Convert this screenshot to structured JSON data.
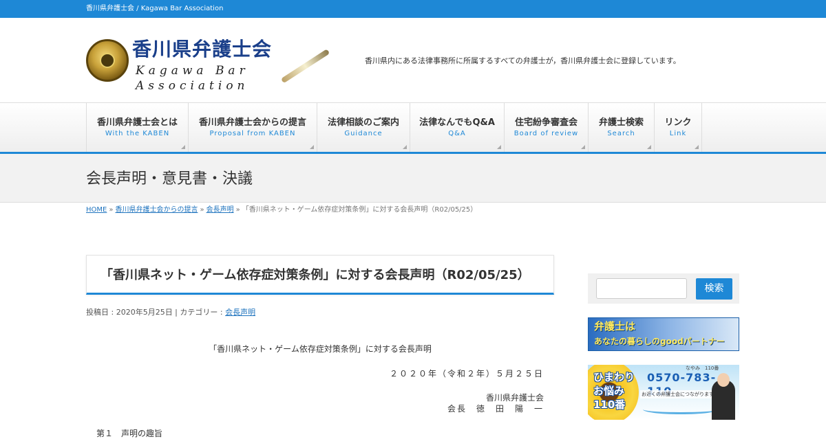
{
  "topbar": {
    "text": "香川県弁護士会 / Kagawa Bar Association"
  },
  "header": {
    "logo_title": "香川県弁護士会",
    "logo_en": "Kagawa Bar Association",
    "description": "香川県内にある法律事務所に所属するすべての弁護士が，香川県弁護士会に登録しています。"
  },
  "nav": {
    "items": [
      {
        "label": "香川県弁護士会とは",
        "sub": "With the KABEN"
      },
      {
        "label": "香川県弁護士会からの提言",
        "sub": "Proposal from KABEN"
      },
      {
        "label": "法律相談のご案内",
        "sub": "Guidance"
      },
      {
        "label": "法律なんでもQ&A",
        "sub": "Q&A"
      },
      {
        "label": "住宅紛争審査会",
        "sub": "Board of review"
      },
      {
        "label": "弁護士検索",
        "sub": "Search"
      },
      {
        "label": "リンク",
        "sub": "Link"
      }
    ]
  },
  "banner": {
    "title": "会長声明・意見書・決議"
  },
  "breadcrumb": {
    "home": "HOME",
    "level1": "香川県弁護士会からの提言",
    "level2": "会長声明",
    "current": "「香川県ネット・ゲーム依存症対策条例」に対する会長声明（R02/05/25）",
    "separator": "»"
  },
  "post": {
    "title": "「香川県ネット・ゲーム依存症対策条例」に対する会長声明（R02/05/25）",
    "meta_prefix": "投稿日 : 2020年5月25日 | カテゴリー : ",
    "category": "会長声明"
  },
  "document": {
    "heading": "「香川県ネット・ゲーム依存症対策条例」に対する会長声明",
    "date": "２０２０年（令和２年）５月２５日",
    "organization": "香川県弁護士会",
    "president": "会長　徳　田　陽　一",
    "section": "第１　声明の趣旨"
  },
  "sidebar": {
    "search_button": "検索",
    "ad1_line1": "弁護士は",
    "ad1_line2": "あなたの暮らしのgoodパートナー",
    "ad2_title_line1": "ひまわり",
    "ad2_title_line2": "お悩み",
    "ad2_title_line3": "110番",
    "ad2_phone": "0570-783-110",
    "ad2_small": "なやみ　110番",
    "ad2_sub": "お近くの弁護士会につながります"
  },
  "colors": {
    "accent": "#1e88d6",
    "link": "#1e73be"
  }
}
